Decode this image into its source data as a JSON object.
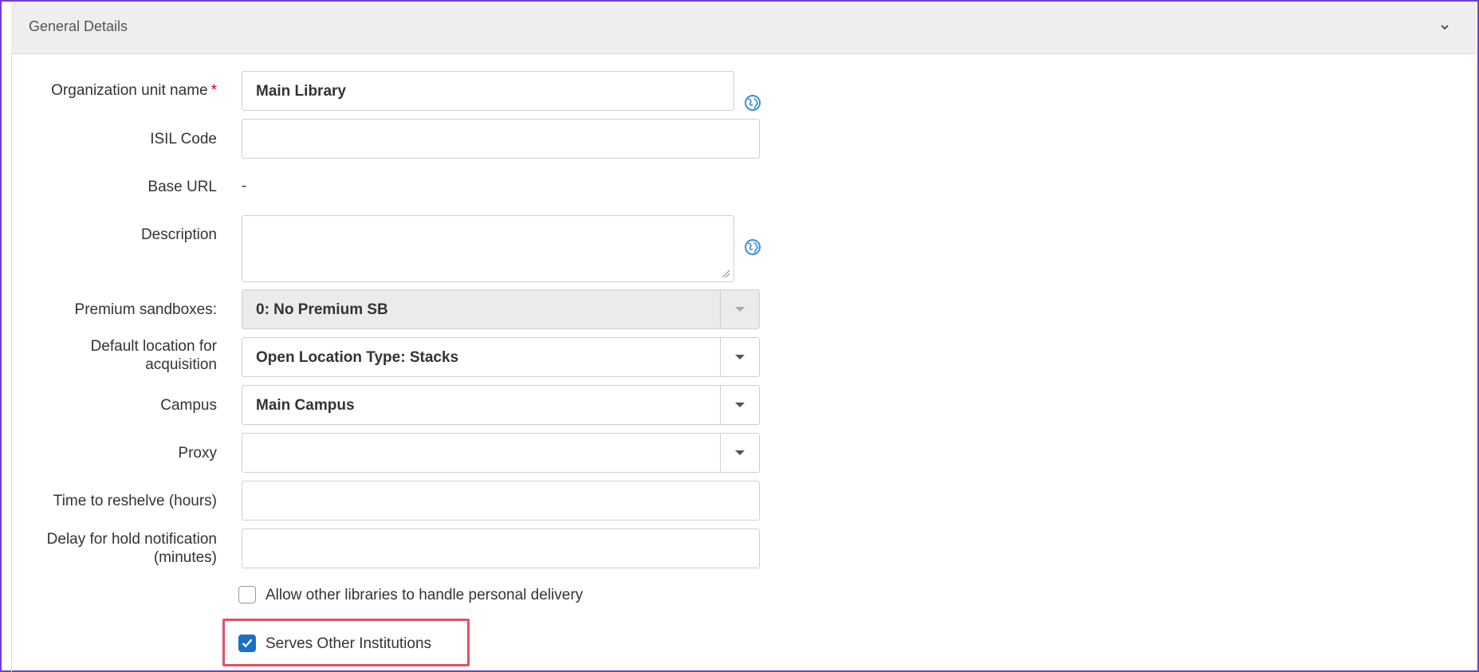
{
  "section": {
    "title": "General Details",
    "toggle_icon": "chevron-down-icon"
  },
  "form": {
    "org_unit_name": {
      "label": "Organization unit name",
      "required_mark": "*",
      "value": "Main Library",
      "translate_icon": "globe-icon"
    },
    "isil_code": {
      "label": "ISIL Code",
      "value": ""
    },
    "base_url": {
      "label": "Base URL",
      "value": "-"
    },
    "description": {
      "label": "Description",
      "value": "",
      "translate_icon": "globe-icon"
    },
    "premium_sandboxes": {
      "label": "Premium sandboxes:",
      "value": "0: No Premium SB",
      "disabled": true
    },
    "default_location": {
      "label_line1": "Default location for",
      "label_line2": "acquisition",
      "value": "Open Location Type: Stacks"
    },
    "campus": {
      "label": "Campus",
      "value": "Main Campus"
    },
    "proxy": {
      "label": "Proxy",
      "value": ""
    },
    "time_to_reshelve": {
      "label": "Time to reshelve (hours)",
      "value": ""
    },
    "delay_hold": {
      "label_line1": "Delay for hold notification",
      "label_line2": "(minutes)",
      "value": ""
    },
    "allow_personal_delivery": {
      "label": "Allow other libraries to handle personal delivery",
      "checked": false
    },
    "serves_other_institutions": {
      "label": "Serves Other Institutions",
      "checked": true
    }
  },
  "colors": {
    "frame_border": "#6c3fd6",
    "highlight_border": "#e05263",
    "checkbox_checked": "#1a6fc9",
    "globe_icon": "#3d8fd6"
  }
}
